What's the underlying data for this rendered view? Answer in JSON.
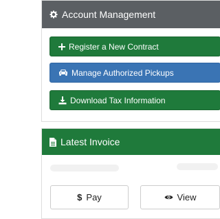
{
  "account": {
    "title": "Account Management",
    "icon": "gear-icon",
    "buttons": [
      {
        "label": "Register a New Contract",
        "icon": "plus-icon",
        "color": "#1f7a3b"
      },
      {
        "label": "Manage Authorized Pickups",
        "icon": "car-icon",
        "color": "#3a74b4"
      },
      {
        "label": "Download Tax Information",
        "icon": "download-icon",
        "color": "#1f7a3b"
      }
    ]
  },
  "invoice": {
    "title": "Latest Invoice",
    "icon": "file-icon",
    "pay_label": "Pay",
    "pay_icon_text": "$",
    "view_label": "View"
  },
  "colors": {
    "header_gray": "#5b5f63",
    "primary_green": "#1f7a3b",
    "primary_blue": "#3a74b4"
  }
}
